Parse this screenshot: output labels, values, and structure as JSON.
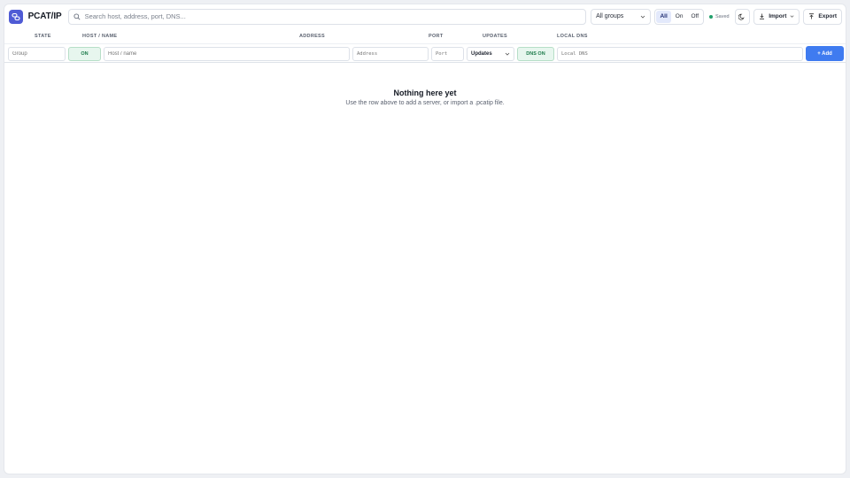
{
  "app": {
    "name": "PCAT/IP"
  },
  "topbar": {
    "search_placeholder": "Search host, address, port, DNS...",
    "groups_select": "All groups",
    "state_filter": [
      {
        "label": "All",
        "active": true
      },
      {
        "label": "On",
        "active": false
      },
      {
        "label": "Off",
        "active": false
      }
    ],
    "status": "Saved",
    "import_label": "Import",
    "export_label": "Export"
  },
  "columns": {
    "state": "STATE",
    "host": "HOST / NAME",
    "address": "ADDRESS",
    "port": "PORT",
    "updates": "UPDATES",
    "local_dns": "LOCAL DNS"
  },
  "new_row": {
    "group_placeholder": "Group",
    "state_toggle": "ON",
    "host_placeholder": "Host / name",
    "address_placeholder": "Address",
    "port_placeholder": "Port",
    "updates_value": "Updates",
    "dns_toggle": "DNS ON",
    "local_dns_placeholder": "Local DNS",
    "add_label": "+ Add"
  },
  "empty_state": {
    "title": "Nothing here yet",
    "message": "Use the row above to add a server, or import a .pcatip file."
  },
  "colors": {
    "accent": "#3f7bf0",
    "brand": "#4f5bd5",
    "on_green": "#1c7a4a",
    "saved_dot": "#22a06b"
  },
  "icons": [
    "link-icon",
    "search-icon",
    "chevron-down-icon",
    "moon-icon",
    "download-icon",
    "upload-icon"
  ]
}
